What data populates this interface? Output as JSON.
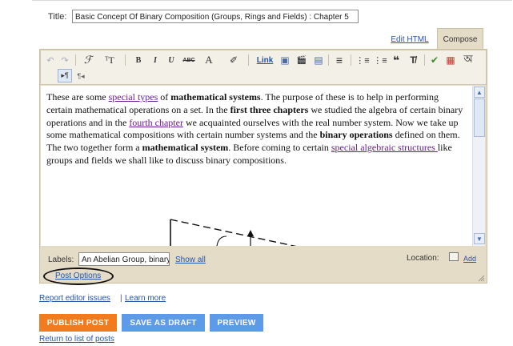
{
  "post": {
    "title_label": "Title:",
    "title_value": "Basic Concept Of Binary Composition (Groups, Rings and Fields) : Chapter 5"
  },
  "tabs": {
    "edit_html": "Edit HTML",
    "compose": "Compose"
  },
  "toolbar": {
    "row1": [
      {
        "name": "undo-icon",
        "glyph": "↶"
      },
      {
        "name": "redo-icon",
        "glyph": "↷"
      },
      {
        "name": "font-icon",
        "glyph": "ℱ"
      },
      {
        "name": "font-size-icon",
        "glyph": "ᵀT"
      },
      {
        "name": "bold-icon",
        "glyph": "B"
      },
      {
        "name": "italic-icon",
        "glyph": "I"
      },
      {
        "name": "underline-icon",
        "glyph": "U"
      },
      {
        "name": "strikethrough-icon",
        "glyph": "ABC"
      },
      {
        "name": "text-color-icon",
        "glyph": "A"
      },
      {
        "name": "highlight-icon",
        "glyph": "✐"
      },
      {
        "name": "link-button",
        "glyph": "Link"
      },
      {
        "name": "image-icon",
        "glyph": "▣"
      },
      {
        "name": "video-icon",
        "glyph": "🎬"
      },
      {
        "name": "jump-break-icon",
        "glyph": "▤"
      },
      {
        "name": "align-icon",
        "glyph": "≡"
      },
      {
        "name": "numbered-list-icon",
        "glyph": "⋮≡"
      },
      {
        "name": "bullet-list-icon",
        "glyph": "⋮≡"
      },
      {
        "name": "quote-icon",
        "glyph": "❝"
      },
      {
        "name": "remove-format-icon",
        "glyph": "T̸"
      },
      {
        "name": "spellcheck-icon",
        "glyph": "✔"
      },
      {
        "name": "pdf-icon",
        "glyph": "▦"
      },
      {
        "name": "transliterate-icon",
        "glyph": "অ"
      }
    ],
    "row2": [
      {
        "name": "ltr-icon",
        "glyph": "▸¶"
      },
      {
        "name": "rtl-icon",
        "glyph": "¶◂"
      }
    ]
  },
  "editor": {
    "segments": [
      {
        "t": "These are some ",
        "s": "n"
      },
      {
        "t": " special types",
        "s": "a"
      },
      {
        "t": " of ",
        "s": "n"
      },
      {
        "t": "mathematical systems",
        "s": "b"
      },
      {
        "t": ". The purpose of these is to help in performing certain mathematical operations on a set. In the ",
        "s": "n"
      },
      {
        "t": "first three chapters",
        "s": "b"
      },
      {
        "t": " we studied the algebra of certain binary operations and in the ",
        "s": "n"
      },
      {
        "t": "fourth chapter",
        "s": "a"
      },
      {
        "t": " we acquainted ourselves with the real number system. Now we take up some mathematical compositions with certain number systems and the ",
        "s": "n"
      },
      {
        "t": "binary operations",
        "s": "b"
      },
      {
        "t": " defined on them. The two together form a ",
        "s": "n"
      },
      {
        "t": "mathematical system",
        "s": "b"
      },
      {
        "t": ". Before coming to certain ",
        "s": "n"
      },
      {
        "t": "special algebraic structures ",
        "s": "a"
      },
      {
        "t": "like groups and fields we shall like to discuss binary compositions.",
        "s": "n"
      }
    ]
  },
  "labels": {
    "label": "Labels:",
    "value": "An Abelian Group, binary",
    "show_all": "Show all",
    "location_label": "Location:",
    "add": "Add",
    "post_options": "Post Options"
  },
  "footer": {
    "report_issues": "Report editor issues",
    "separator": "|",
    "learn_more": "Learn more",
    "publish": "PUBLISH POST",
    "save_draft": "SAVE AS DRAFT",
    "preview": "PREVIEW",
    "return": "Return to list of posts"
  },
  "colors": {
    "publish_bg": "#f27b1e",
    "secondary_btn_bg": "#5d9be8",
    "editor_frame": "#e5dcc8",
    "link": "#2255aa",
    "visited_link": "#6a1b9a"
  }
}
